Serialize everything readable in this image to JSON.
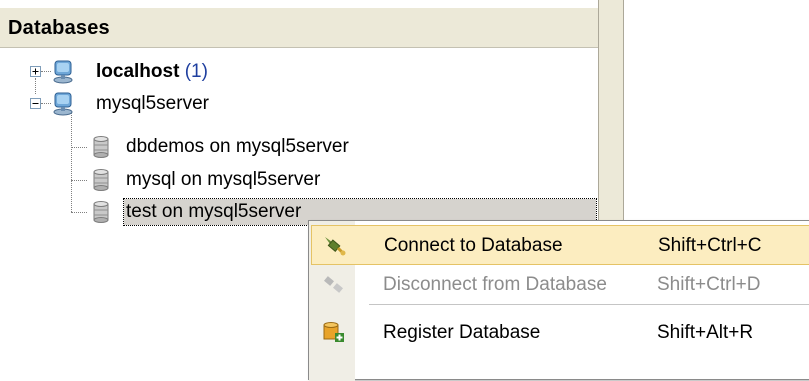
{
  "panel": {
    "header": "Databases"
  },
  "tree": {
    "localhost": {
      "name": "localhost",
      "count": "(1)",
      "expanded": false
    },
    "mysql5server": {
      "name": "mysql5server",
      "expanded": true,
      "children": [
        {
          "label": "dbdemos on mysql5server"
        },
        {
          "label": "mysql on mysql5server"
        },
        {
          "label": "test on mysql5server",
          "selected": true
        }
      ]
    }
  },
  "context_menu": {
    "items": [
      {
        "label": "Connect to Database",
        "shortcut": "Shift+Ctrl+C",
        "state": "highlighted",
        "icon": "plug-connect-icon"
      },
      {
        "label": "Disconnect from Database",
        "shortcut": "Shift+Ctrl+D",
        "state": "disabled",
        "icon": "plug-disconnect-icon"
      },
      {
        "label": "Register Database",
        "shortcut": "Shift+Alt+R",
        "state": "normal",
        "icon": "database-register-icon"
      }
    ]
  },
  "colors": {
    "header_bg": "#ece9d8",
    "selection_bg": "#d6d3ce",
    "menu_highlight": "#fcedc0",
    "menu_highlight_border": "#e5c365",
    "disabled_text": "#8c8c8c"
  }
}
